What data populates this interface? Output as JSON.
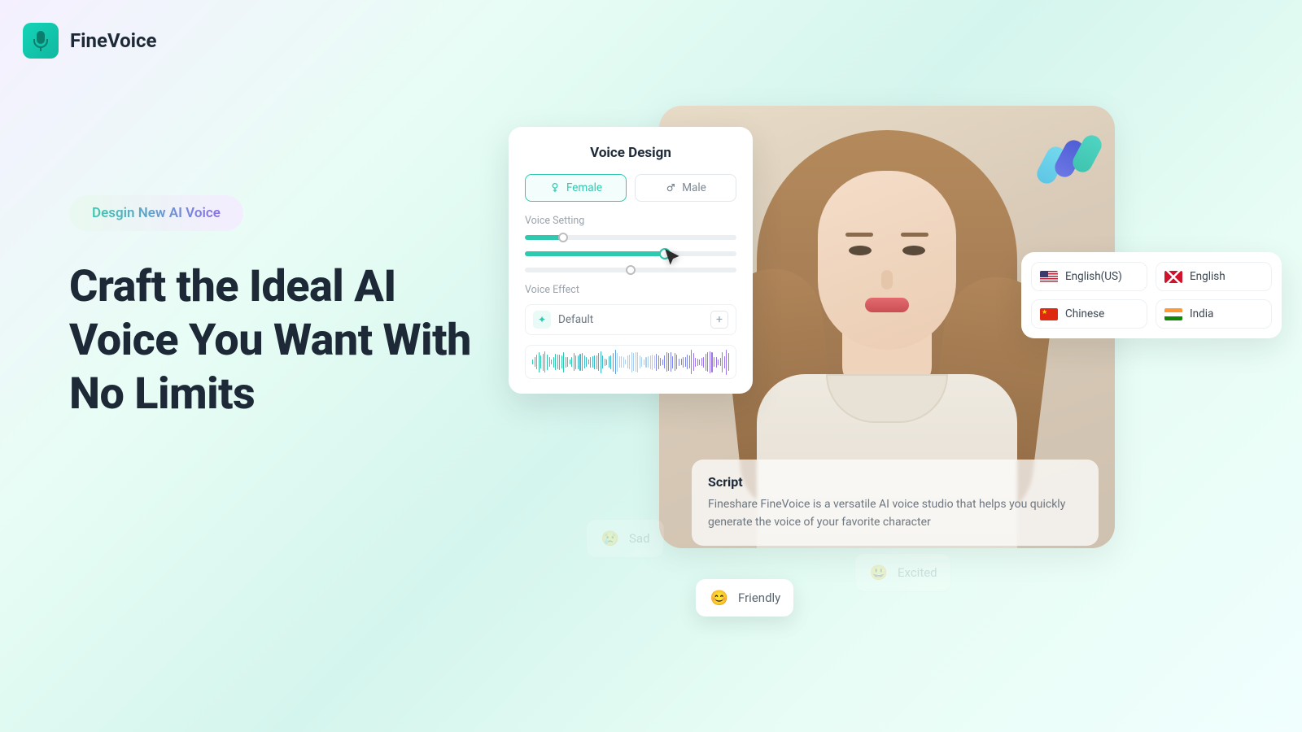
{
  "header": {
    "brand": "FineVoice"
  },
  "hero": {
    "pill": "Desgin New AI Voice",
    "headline": "Craft the Ideal AI Voice You Want With No Limits"
  },
  "voice_design": {
    "title": "Voice Design",
    "gender": {
      "female": "Female",
      "male": "Male",
      "selected": "female"
    },
    "setting_label": "Voice Setting",
    "sliders": [
      {
        "value_pct": 18
      },
      {
        "value_pct": 66
      },
      {
        "value_pct": 50
      }
    ],
    "effect_label": "Voice Effect",
    "effect_value": "Default"
  },
  "script": {
    "title": "Script",
    "body": "Fineshare FineVoice is a versatile AI voice studio that helps you quickly generate the voice of your favorite character"
  },
  "languages": {
    "items": [
      {
        "id": "us",
        "label": "English(US)"
      },
      {
        "id": "uk",
        "label": "English"
      },
      {
        "id": "cn",
        "label": "Chinese"
      },
      {
        "id": "in",
        "label": "India"
      }
    ]
  },
  "moods": {
    "friendly": "Friendly",
    "sad": "Sad",
    "excited": "Excited"
  },
  "colors": {
    "accent": "#2fc9b0"
  }
}
